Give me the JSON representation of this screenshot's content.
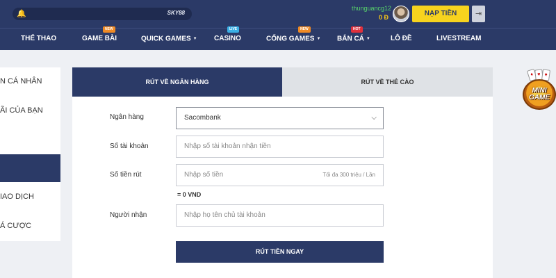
{
  "header": {
    "marquee_text": "SKY88",
    "username": "thunguancg12",
    "balance": "0 Đ",
    "deposit_label": "NẠP TIỀN",
    "logout_icon": "logout-icon"
  },
  "nav": {
    "items": [
      {
        "label": "THỂ THAO"
      },
      {
        "label": "GAME BÀI",
        "badge": "NEW"
      },
      {
        "label": "QUICK GAMES"
      },
      {
        "label": "CASINO",
        "badge": "LIVE"
      },
      {
        "label": "CỔNG GAMES",
        "badge": "NEW"
      },
      {
        "label": "BẮN CÁ",
        "badge": "HOT"
      },
      {
        "label": "LÔ ĐỀ"
      },
      {
        "label": "LIVESTREAM"
      }
    ]
  },
  "sidebar": {
    "items": [
      {
        "label": "N CÁ NHÂN"
      },
      {
        "label": "ÃI CỦA BẠN"
      },
      {
        "label": ""
      },
      {
        "label": ""
      },
      {
        "label": "IAO DỊCH"
      },
      {
        "label": "Á CƯỢC"
      }
    ]
  },
  "withdraw": {
    "tabs": [
      "RÚT VỀ NGÂN HÀNG",
      "RÚT VỀ THẺ CÀO"
    ],
    "bank_label": "Ngân hàng",
    "bank_value": "Sacombank",
    "account_label": "Số tài khoản",
    "account_placeholder": "Nhập số tài khoản nhận tiền",
    "amount_label": "Số tiền rút",
    "amount_placeholder": "Nhập số tiền",
    "amount_limit": "Tối đa 300 triệu / Lần",
    "converted": "= 0 VND",
    "recipient_label": "Người nhận",
    "recipient_placeholder": "Nhập họ tên chủ tài khoản",
    "submit_label": "RÚT TIỀN NGAY"
  },
  "minigame": {
    "text_line1": "MINI",
    "text_line2": "GAME"
  },
  "colors": {
    "brand": "#2b3a67",
    "accent": "#f7d31e",
    "username": "#58d36b"
  }
}
